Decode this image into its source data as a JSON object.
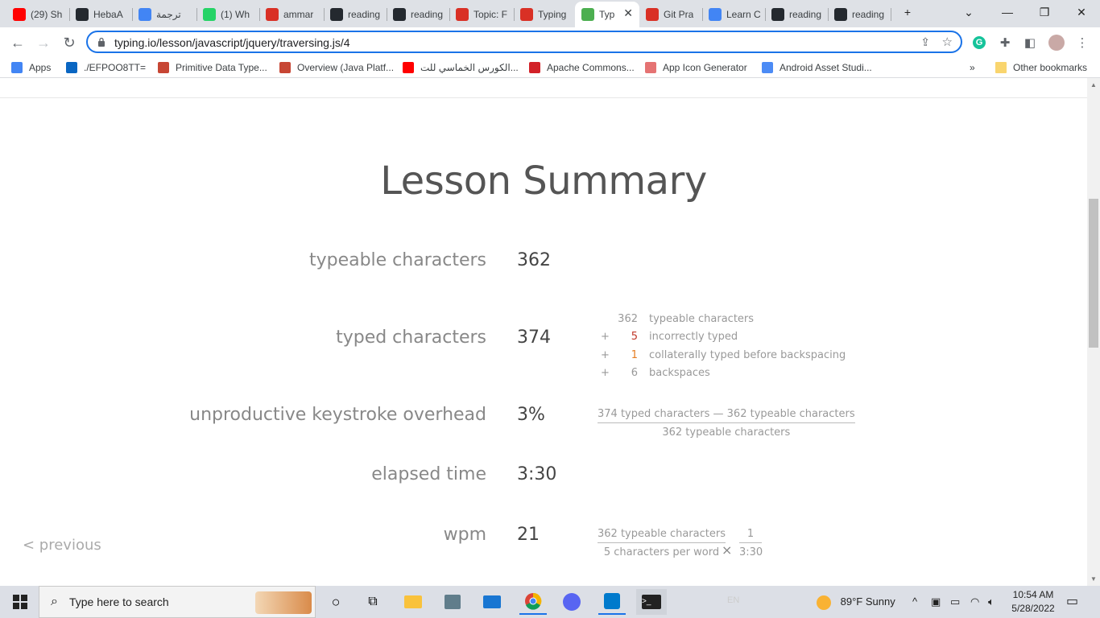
{
  "browser": {
    "tabs": [
      {
        "label": "(29) Sh",
        "icon": "youtube-icon",
        "color": "#ff0000"
      },
      {
        "label": "HebaA",
        "icon": "github-icon",
        "color": "#24292f"
      },
      {
        "label": "ترجمة",
        "icon": "google-translate-icon",
        "color": "#4285f4"
      },
      {
        "label": "(1) Wh",
        "icon": "whatsapp-icon",
        "color": "#25d366"
      },
      {
        "label": "ammar",
        "icon": "spinner-icon",
        "color": "#d93025"
      },
      {
        "label": "reading",
        "icon": "github-icon",
        "color": "#24292f"
      },
      {
        "label": "reading",
        "icon": "github-icon",
        "color": "#24292f"
      },
      {
        "label": "Topic: F",
        "icon": "spinner-icon",
        "color": "#d93025"
      },
      {
        "label": "Typing",
        "icon": "typing-icon",
        "color": "#d93025"
      },
      {
        "label": "Typ",
        "icon": "typing-t-icon",
        "color": "#4caf50",
        "active": true
      },
      {
        "label": "Git Pra",
        "icon": "typing-icon",
        "color": "#d93025"
      },
      {
        "label": "Learn C",
        "icon": "learn-icon",
        "color": "#4285f4"
      },
      {
        "label": "reading",
        "icon": "github-icon",
        "color": "#24292f"
      },
      {
        "label": "reading",
        "icon": "github-icon",
        "color": "#24292f"
      }
    ],
    "url": "typing.io/lesson/javascript/jquery/traversing.js/4",
    "bookmarks": [
      {
        "label": "Apps",
        "icon": "apps-grid-icon"
      },
      {
        "label": "./EFPOO8TT=",
        "icon": "linkedin-icon"
      },
      {
        "label": "Primitive Data Type...",
        "icon": "oracle-icon"
      },
      {
        "label": "Overview (Java Platf...",
        "icon": "oracle-icon"
      },
      {
        "label": "الكورس الخماسي للت...",
        "icon": "youtube-icon"
      },
      {
        "label": "Apache Commons...",
        "icon": "feather-icon"
      },
      {
        "label": "App Icon Generator",
        "icon": "app-icon-generator-icon"
      },
      {
        "label": "Android Asset Studi...",
        "icon": "android-asset-icon"
      }
    ],
    "bookmarks_overflow": "»",
    "other_bookmarks": "Other bookmarks"
  },
  "summary": {
    "title": "Lesson Summary",
    "typeable_label": "typeable characters",
    "typeable_value": "362",
    "typed_label": "typed characters",
    "typed_value": "374",
    "breakdown": [
      {
        "op": "",
        "num": "362",
        "text": "typeable characters"
      },
      {
        "op": "+",
        "num": "5",
        "text": "incorrectly typed"
      },
      {
        "op": "+",
        "num": "1",
        "text": "collaterally typed before backspacing"
      },
      {
        "op": "+",
        "num": "6",
        "text": "backspaces"
      }
    ],
    "overhead_label": "unproductive keystroke overhead",
    "overhead_value": "3%",
    "overhead_numerator": "374 typed characters — 362 typeable characters",
    "overhead_denominator": "362 typeable characters",
    "elapsed_label": "elapsed time",
    "elapsed_value": "3:30",
    "wpm_label": "wpm",
    "wpm_value": "21",
    "wpm_num1": "362 typeable characters",
    "wpm_den1": "5 characters per word",
    "wpm_times": "×",
    "wpm_num2": "1",
    "wpm_den2": "3:30",
    "previous_link": "< previous"
  },
  "taskbar": {
    "search_placeholder": "Type here to search",
    "weather": "89°F  Sunny",
    "time": "10:54 AM",
    "date": "5/28/2022",
    "lang": "EN"
  }
}
